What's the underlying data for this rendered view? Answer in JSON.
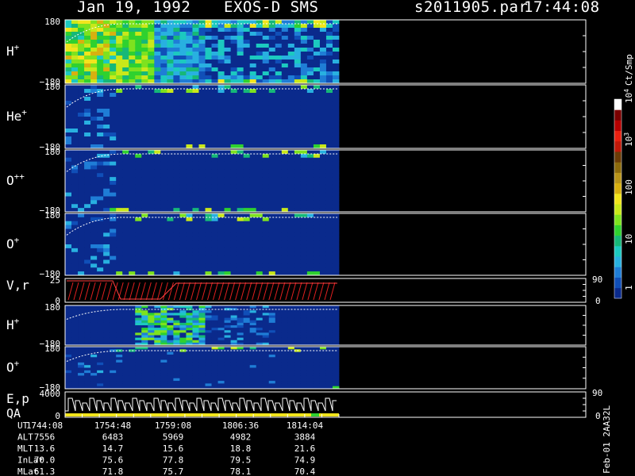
{
  "header": {
    "date": "Jan 19, 1992",
    "instrument": "EXOS-D SMS",
    "file": "s2011905.par",
    "time": "17:44:08"
  },
  "colorbar": {
    "unit": "Ct/Smp",
    "labels": [
      {
        "text": "10",
        "sup": "4",
        "value": 10000
      },
      {
        "text": "10",
        "sup": "3",
        "value": 1000
      },
      {
        "text": "100",
        "sup": "",
        "value": 100
      },
      {
        "text": "10",
        "sup": "",
        "value": 10
      },
      {
        "text": "1",
        "sup": "",
        "value": 1
      }
    ],
    "colors": [
      "#0a2a8c",
      "#104fb8",
      "#1f7dd6",
      "#28b0e0",
      "#1cc9c0",
      "#16b878",
      "#2fd12f",
      "#7ee21f",
      "#c9e81a",
      "#f2e51c",
      "#d8b010",
      "#b8941a",
      "#8c6a0c",
      "#6b3b06",
      "#c01808",
      "#e82010",
      "#b40000",
      "#7a0000",
      "#ffffff"
    ]
  },
  "chart_data": {
    "type": "heatmap",
    "time_range_ut": [
      "1744:08",
      "1814:04"
    ],
    "data_extent_ut": "1814:04",
    "panels": [
      {
        "name": "H+",
        "label": "H",
        "sup": "+",
        "kind": "spectrogram",
        "ylim": [
          -180,
          180
        ],
        "ytick_top": "180",
        "ytick_bottom": "−180",
        "style": "dense"
      },
      {
        "name": "He+",
        "label": "He",
        "sup": "+",
        "kind": "spectrogram",
        "ylim": [
          -180,
          180
        ],
        "ytick_top": "180",
        "ytick_bottom": "−180",
        "style": "sparse"
      },
      {
        "name": "O++",
        "label": "O",
        "sup": "++",
        "kind": "spectrogram",
        "ylim": [
          -180,
          180
        ],
        "ytick_top": "180",
        "ytick_bottom": "−180",
        "style": "sparse"
      },
      {
        "name": "O+",
        "label": "O",
        "sup": "+",
        "kind": "spectrogram",
        "ylim": [
          -180,
          180
        ],
        "ytick_top": "180",
        "ytick_bottom": "−180",
        "style": "sparse"
      },
      {
        "name": "V,r",
        "label": "V,r",
        "sup": "",
        "kind": "line",
        "ylim": [
          0,
          25
        ],
        "ytick_top": "25",
        "ytick_bottom": "0",
        "right_top": "90",
        "right_bottom": "0"
      },
      {
        "name": "H+",
        "label": "H",
        "sup": "+",
        "kind": "spectrogram",
        "ylim": [
          -180,
          180
        ],
        "ytick_top": "180",
        "ytick_bottom": "−180",
        "style": "bands"
      },
      {
        "name": "O+",
        "label": "O",
        "sup": "+",
        "kind": "spectrogram",
        "ylim": [
          -180,
          180
        ],
        "ytick_top": "180",
        "ytick_bottom": "−180",
        "style": "sparse2"
      },
      {
        "name": "E,p QA",
        "label": "E,p",
        "label2": "QA",
        "sup": "",
        "kind": "step",
        "ylim": [
          0,
          4000
        ],
        "ytick_top": "4000",
        "ytick_bottom": "0",
        "right_top": "90",
        "right_bottom": "0"
      }
    ]
  },
  "footer": {
    "rows": [
      {
        "label": "UT",
        "values": [
          "1744:08",
          "1754:48",
          "1759:08",
          "1806:36",
          "1814:04"
        ]
      },
      {
        "label": "ALT",
        "values": [
          "7556",
          "6483",
          "5969",
          "4982",
          "3884"
        ]
      },
      {
        "label": "MLT",
        "values": [
          "13.6",
          "14.7",
          "15.6",
          "18.8",
          "21.6"
        ]
      },
      {
        "label": "InLat",
        "values": [
          "70.0",
          "75.6",
          "77.8",
          "79.5",
          "74.9"
        ]
      },
      {
        "label": "MLat",
        "values": [
          "61.3",
          "71.8",
          "75.7",
          "78.1",
          "70.4"
        ]
      }
    ],
    "side_note": "Feb-01 2AA32L"
  }
}
